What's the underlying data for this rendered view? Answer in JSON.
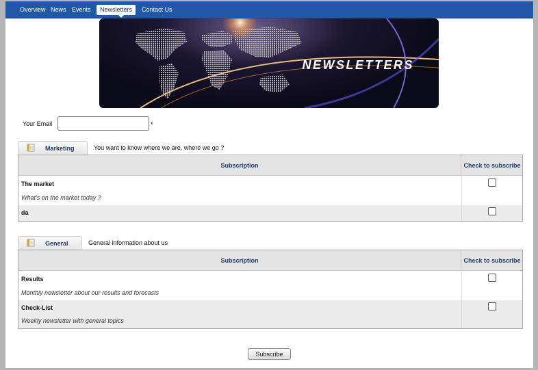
{
  "nav": {
    "items": [
      {
        "label": "Overview"
      },
      {
        "label": "News"
      },
      {
        "label": "Events"
      },
      {
        "label": "Newsletters",
        "active": true
      },
      {
        "label": "Contact Us"
      }
    ]
  },
  "banner": {
    "title": "NEWSLETTERS"
  },
  "email": {
    "label": "Your Email",
    "value": "",
    "placeholder": "",
    "required_mark": "*"
  },
  "sections": [
    {
      "tab_label": "Marketing",
      "tab_icon": "book-icon",
      "description": "You want to know where we are, where we go ?",
      "col_subscription": "Subscription",
      "col_check": "Check to subscribe",
      "rows": [
        {
          "name": "The market",
          "desc": "What's on the market today ?",
          "checked": false
        },
        {
          "name": "da",
          "desc": "",
          "checked": false
        }
      ]
    },
    {
      "tab_label": "General",
      "tab_icon": "book-icon",
      "description": "General information about us",
      "col_subscription": "Subscription",
      "col_check": "Check to subscribe",
      "rows": [
        {
          "name": "Results",
          "desc": "Monthly newsletter about our results and forecasts",
          "checked": false
        },
        {
          "name": "Check-List",
          "desc": "Weekly newsletter with general topics",
          "checked": false
        }
      ]
    }
  ],
  "submit": {
    "label": "Subscribe"
  },
  "colors": {
    "nav_bar": "#1f58a7",
    "header_text": "#1f3c6a",
    "row_alt": "#ececec"
  }
}
